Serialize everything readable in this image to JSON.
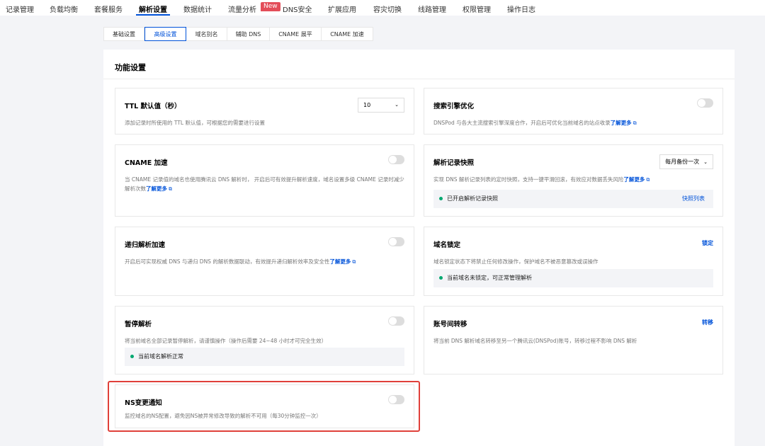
{
  "nav": {
    "items": [
      "记录管理",
      "负载均衡",
      "套餐服务",
      "解析设置",
      "数据统计",
      "流量分析",
      "DNS安全",
      "扩展应用",
      "容灾切换",
      "线路管理",
      "权限管理",
      "操作日志"
    ],
    "active": "解析设置",
    "new_badge": "New"
  },
  "subtabs": {
    "items": [
      "基础设置",
      "高级设置",
      "域名别名",
      "辅助 DNS",
      "CNAME 展平",
      "CNAME 加速"
    ],
    "active": "高级设置"
  },
  "panel": {
    "title": "功能设置"
  },
  "learn_more": "了解更多",
  "cards": {
    "ttl": {
      "title": "TTL 默认值（秒）",
      "desc": "添加记录时所使用的 TTL 默认值，可根据您的需要进行设置",
      "value": "10"
    },
    "seo": {
      "title": "搜索引擎优化",
      "desc": "DNSPod 与各大主流搜索引擎深度合作，开启后可优化当前域名的站点收录",
      "enabled": false
    },
    "cname": {
      "title": "CNAME 加速",
      "desc": "当 CNAME 记录值的域名也使用腾讯云 DNS 解析时， 开启后可有效提升解析速度，域名设置多级 CNAME 记录时减少解析次数",
      "enabled": false
    },
    "snapshot": {
      "title": "解析记录快照",
      "desc": "实现 DNS 解析记录列表的定时快照，支持一键平滑回滚，有效应对数据丢失风险",
      "value": "每月备份一次",
      "status": "已开启解析记录快照",
      "action": "快照列表"
    },
    "recursive": {
      "title": "递归解析加速",
      "desc": "开启后可实现权威 DNS 与递归 DNS 的解析数据联动，有效提升递归解析效率及安全性",
      "enabled": false
    },
    "lock": {
      "title": "域名锁定",
      "desc": "域名锁定状态下将禁止任何修改操作，保护域名不被恶意篡改或误操作",
      "action": "锁定",
      "status": "当前域名未锁定，可正常管理解析"
    },
    "pause": {
      "title": "暂停解析",
      "desc": "将当前域名全部记录暂停解析，请谨慎操作（操作后需要 24~48 小时才可完全生效）",
      "status": "当前域名解析正常",
      "enabled": false
    },
    "transfer": {
      "title": "账号间转移",
      "desc": "将当前 DNS 解析域名转移至另一个腾讯云(DNSPod)账号，转移过程不影响 DNS 解析",
      "action": "转移"
    },
    "ns": {
      "title": "NS变更通知",
      "desc": "监控域名的NS配置，避免因NS被异常修改导致的解析不可用（每30分钟监控一次）",
      "enabled": false
    }
  }
}
